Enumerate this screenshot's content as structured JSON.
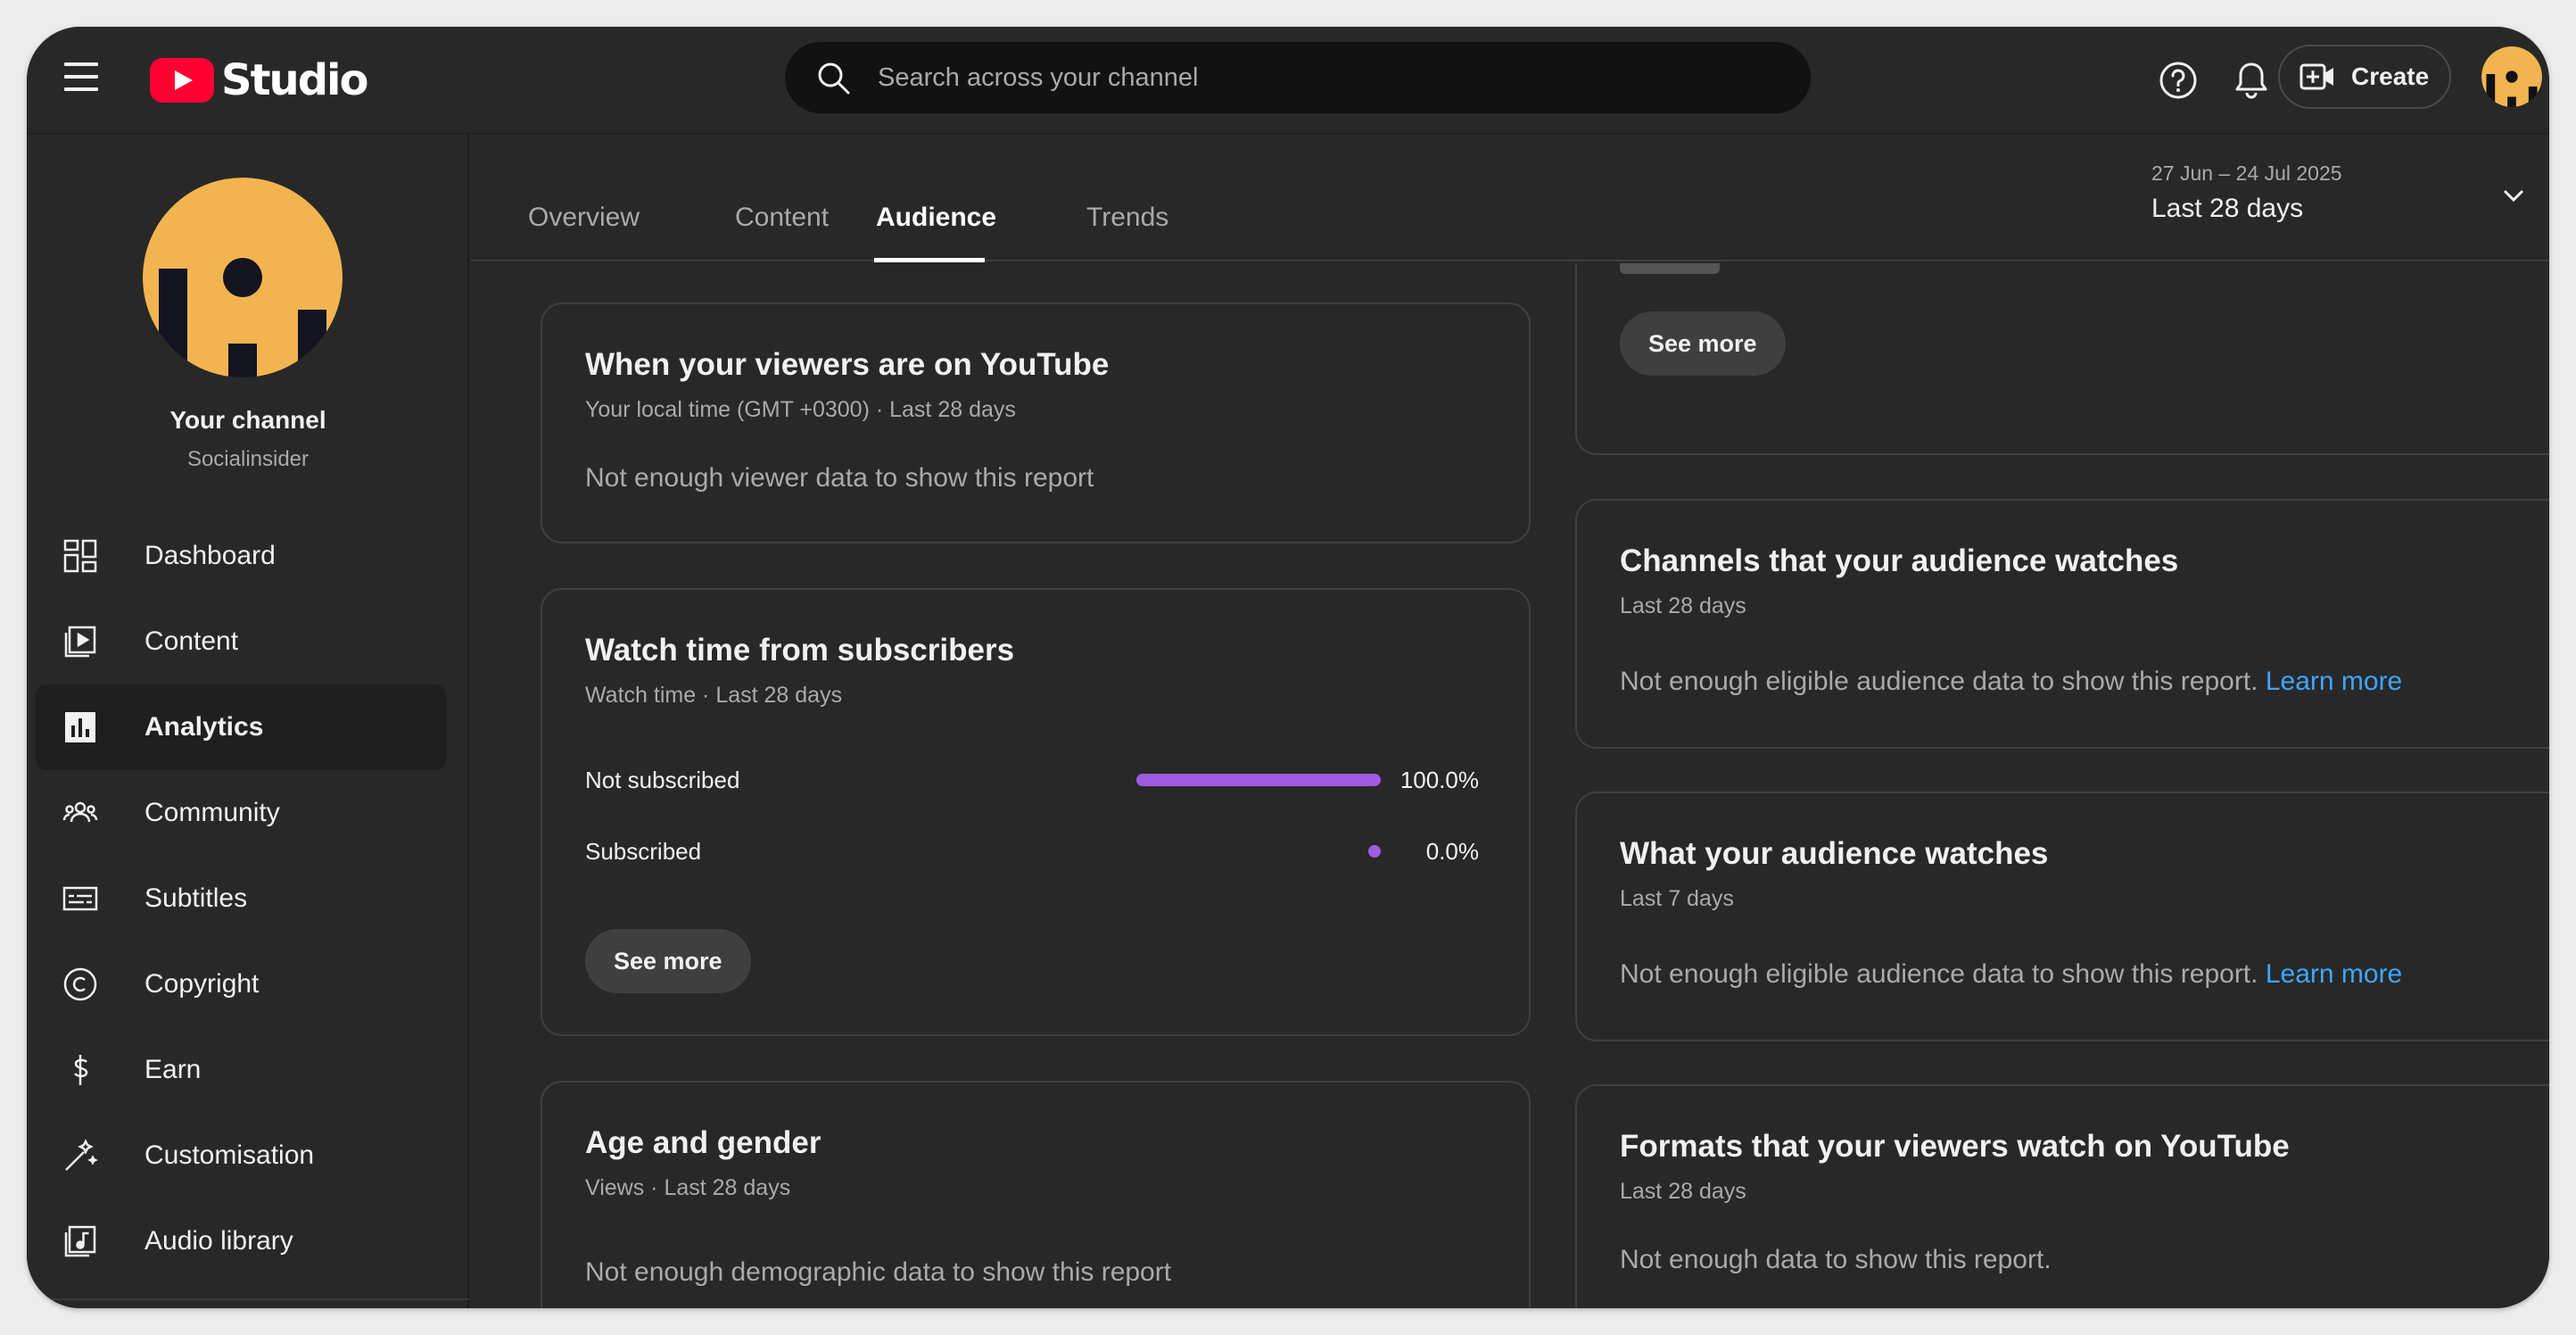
{
  "app": {
    "logo_text": "Studio",
    "brand_color": "#ff0033"
  },
  "search": {
    "placeholder": "Search across your channel"
  },
  "topbar": {
    "help_icon": "help-circle-icon",
    "notifications_icon": "bell-icon",
    "create_label": "Create"
  },
  "channel": {
    "name": "Your channel",
    "handle": "Socialinsider"
  },
  "sidebar": {
    "items": [
      {
        "label": "Dashboard",
        "icon": "dashboard-icon"
      },
      {
        "label": "Content",
        "icon": "content-icon"
      },
      {
        "label": "Analytics",
        "icon": "analytics-icon",
        "active": true
      },
      {
        "label": "Community",
        "icon": "community-icon"
      },
      {
        "label": "Subtitles",
        "icon": "subtitles-icon"
      },
      {
        "label": "Copyright",
        "icon": "copyright-icon"
      },
      {
        "label": "Earn",
        "icon": "earn-icon"
      },
      {
        "label": "Customisation",
        "icon": "customisation-icon"
      },
      {
        "label": "Audio library",
        "icon": "audio-library-icon"
      }
    ]
  },
  "tabs": [
    {
      "label": "Overview"
    },
    {
      "label": "Content"
    },
    {
      "label": "Audience",
      "active": true
    },
    {
      "label": "Trends"
    }
  ],
  "date_picker": {
    "range": "27 Jun – 24 Jul 2025",
    "label": "Last 28 days"
  },
  "cards": {
    "viewers_time": {
      "title": "When your viewers are on YouTube",
      "subtitle": "Your local time (GMT +0300) · Last 28 days",
      "message": "Not enough viewer data to show this report"
    },
    "watch_time": {
      "title": "Watch time from subscribers",
      "subtitle": "Watch time · Last 28 days",
      "rows": [
        {
          "label": "Not subscribed",
          "value": "100.0%",
          "fraction": 1.0
        },
        {
          "label": "Subscribed",
          "value": "0.0%",
          "fraction": 0.0
        }
      ],
      "bar_color": "#a05ae0",
      "see_more": "See more"
    },
    "age_gender": {
      "title": "Age and gender",
      "subtitle": "Views · Last 28 days",
      "message": "Not enough demographic data to show this report"
    },
    "top_right": {
      "see_more": "See more"
    },
    "channels_watched": {
      "title": "Channels that your audience watches",
      "subtitle": "Last 28 days",
      "message": "Not enough eligible audience data to show this report.",
      "link": "Learn more"
    },
    "audience_watches": {
      "title": "What your audience watches",
      "subtitle": "Last 7 days",
      "message": "Not enough eligible audience data to show this report.",
      "link": "Learn more"
    },
    "formats": {
      "title": "Formats that your viewers watch on YouTube",
      "subtitle": "Last 28 days",
      "message": "Not enough data to show this report."
    }
  },
  "colors": {
    "background": "#282828",
    "link": "#3ea6ff",
    "avatar": "#f2b450"
  }
}
